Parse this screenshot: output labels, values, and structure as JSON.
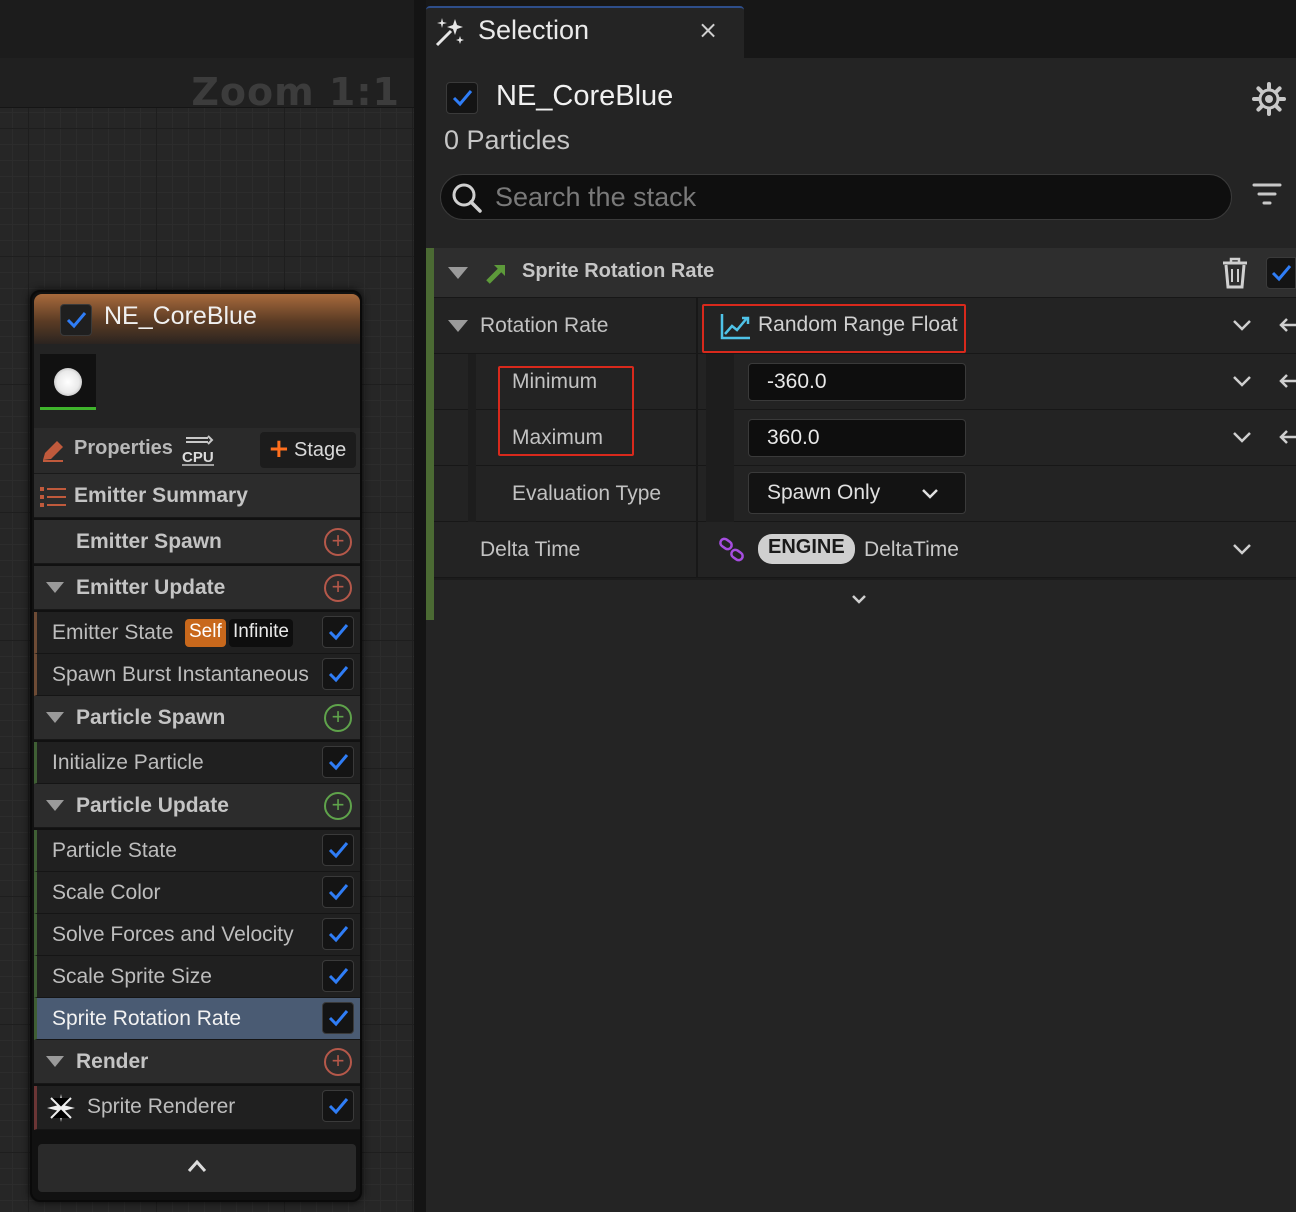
{
  "graph": {
    "zoom_label": "Zoom 1:1"
  },
  "node": {
    "title": "NE_CoreBlue",
    "enabled": true,
    "properties_label": "Properties",
    "cpu_label": "CPU",
    "stage_label": "Stage",
    "summary_label": "Emitter Summary",
    "collapse_icon": "chevron-up-icon",
    "sections": {
      "emitter_spawn": "Emitter Spawn",
      "emitter_update": "Emitter Update",
      "particle_spawn": "Particle Spawn",
      "particle_update": "Particle Update",
      "render": "Render"
    },
    "modules": {
      "emitter_state": "Emitter State",
      "emitter_state_tag_self": "Self",
      "emitter_state_tag_infinite": "Infinite",
      "spawn_burst": "Spawn Burst Instantaneous",
      "initialize_particle": "Initialize Particle",
      "particle_state": "Particle State",
      "scale_color": "Scale Color",
      "solve_forces": "Solve Forces and Velocity",
      "scale_sprite_size": "Scale Sprite Size",
      "sprite_rotation_rate": "Sprite Rotation Rate",
      "sprite_renderer": "Sprite Renderer"
    },
    "selected_module": "Sprite Rotation Rate"
  },
  "panel": {
    "tab_title": "Selection",
    "tab_close": "×",
    "emitter_name": "NE_CoreBlue",
    "particles_count": "0 Particles",
    "search_placeholder": "Search the stack",
    "module": {
      "title": "Sprite Rotation Rate",
      "rows": {
        "rotation_rate_label": "Rotation Rate",
        "rotation_rate_value": "Random Range Float",
        "minimum_label": "Minimum",
        "minimum_value": "-360.0",
        "maximum_label": "Maximum",
        "maximum_value": "360.0",
        "evaluation_type_label": "Evaluation Type",
        "evaluation_type_value": "Spawn Only",
        "delta_time_label": "Delta Time",
        "delta_time_badge": "ENGINE",
        "delta_time_value": "DeltaTime"
      }
    }
  },
  "colors": {
    "accent_check": "#2f7df6",
    "emitter_header": "#a86a3c",
    "highlight_box": "#d8291c",
    "module_group_bar": "#4b6a33",
    "selected_row": "#4a5b73",
    "stage_plus": "#ff6f1e"
  }
}
